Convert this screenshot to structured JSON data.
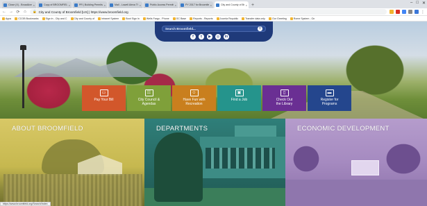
{
  "browser": {
    "tabs": [
      {
        "title": "Close (X) - BroadAvenue",
        "active": false
      },
      {
        "title": "Copy of BROOMFIELD",
        "active": false
      },
      {
        "title": "PR | Building Permits",
        "active": false
      },
      {
        "title": "Mail - Lowell Alexa Thomas",
        "active": false
      },
      {
        "title": "Public Access Permits Onl",
        "active": false
      },
      {
        "title": "PY 2017 for Broomfield",
        "active": false
      },
      {
        "title": "City and County of Broo",
        "active": true
      }
    ],
    "url": "City and County of Broomfield [US] | https://www.broomfield.org",
    "bookmarks": [
      "Apps",
      "CCOB Bookmarks",
      "Sign in - City and C",
      "City and County of",
      "Intranet System",
      "Boot Sign In",
      "Wells Fargo - Phone",
      "GC Base",
      "Reports - Reports",
      "Joomla Republic",
      "Transfer data only",
      "Our Greeting",
      "Rome System - On"
    ]
  },
  "site": {
    "search_placeholder": "Search Broomfield...",
    "social": [
      "f",
      "t",
      "▶",
      "◎",
      "in"
    ],
    "tiles": [
      {
        "label": "Pay Your Bill",
        "icon": "card-icon",
        "color": "#d2572b"
      },
      {
        "label": "City Council &\nAgendas",
        "icon": "clipboard-icon",
        "color": "#7fa03a"
      },
      {
        "label": "Have Fun with\nRecreation",
        "icon": "people-icon",
        "color": "#c97f1e"
      },
      {
        "label": "Find a Job",
        "icon": "briefcase-icon",
        "color": "#25948c"
      },
      {
        "label": "Check Out\nthe Library",
        "icon": "book-icon",
        "color": "#6a2f93"
      },
      {
        "label": "Register for\nPrograms",
        "icon": "laptop-icon",
        "color": "#24468d"
      }
    ],
    "panels": [
      {
        "title": "About Broomfield"
      },
      {
        "title": "Departments"
      },
      {
        "title": "Economic Development"
      }
    ],
    "status_url": "https://www.broomfield.org/Search/Index"
  }
}
